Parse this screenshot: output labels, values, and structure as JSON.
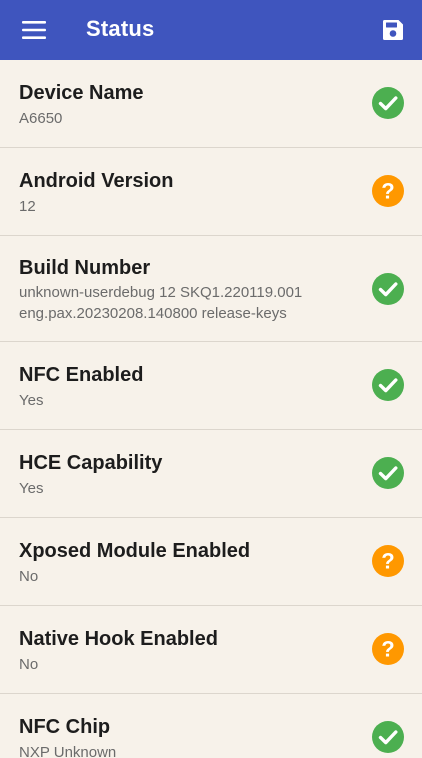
{
  "app_bar": {
    "title": "Status",
    "menu_icon": "menu-icon",
    "save_icon": "save-icon",
    "color": "#3f55be"
  },
  "colors": {
    "ok": "#4caf50",
    "unknown": "#ff9800",
    "background": "#f7f2ea"
  },
  "items": [
    {
      "title": "Device Name",
      "value": "A6650",
      "status": "ok"
    },
    {
      "title": "Android Version",
      "value": "12",
      "status": "unknown"
    },
    {
      "title": "Build Number",
      "value": "unknown-userdebug 12 SKQ1.220119.001\neng.pax.20230208.140800 release-keys",
      "status": "ok"
    },
    {
      "title": "NFC Enabled",
      "value": "Yes",
      "status": "ok"
    },
    {
      "title": "HCE Capability",
      "value": "Yes",
      "status": "ok"
    },
    {
      "title": "Xposed Module Enabled",
      "value": "No",
      "status": "unknown"
    },
    {
      "title": "Native Hook Enabled",
      "value": "No",
      "status": "unknown"
    },
    {
      "title": "NFC Chip",
      "value": "NXP Unknown",
      "status": "ok"
    }
  ]
}
